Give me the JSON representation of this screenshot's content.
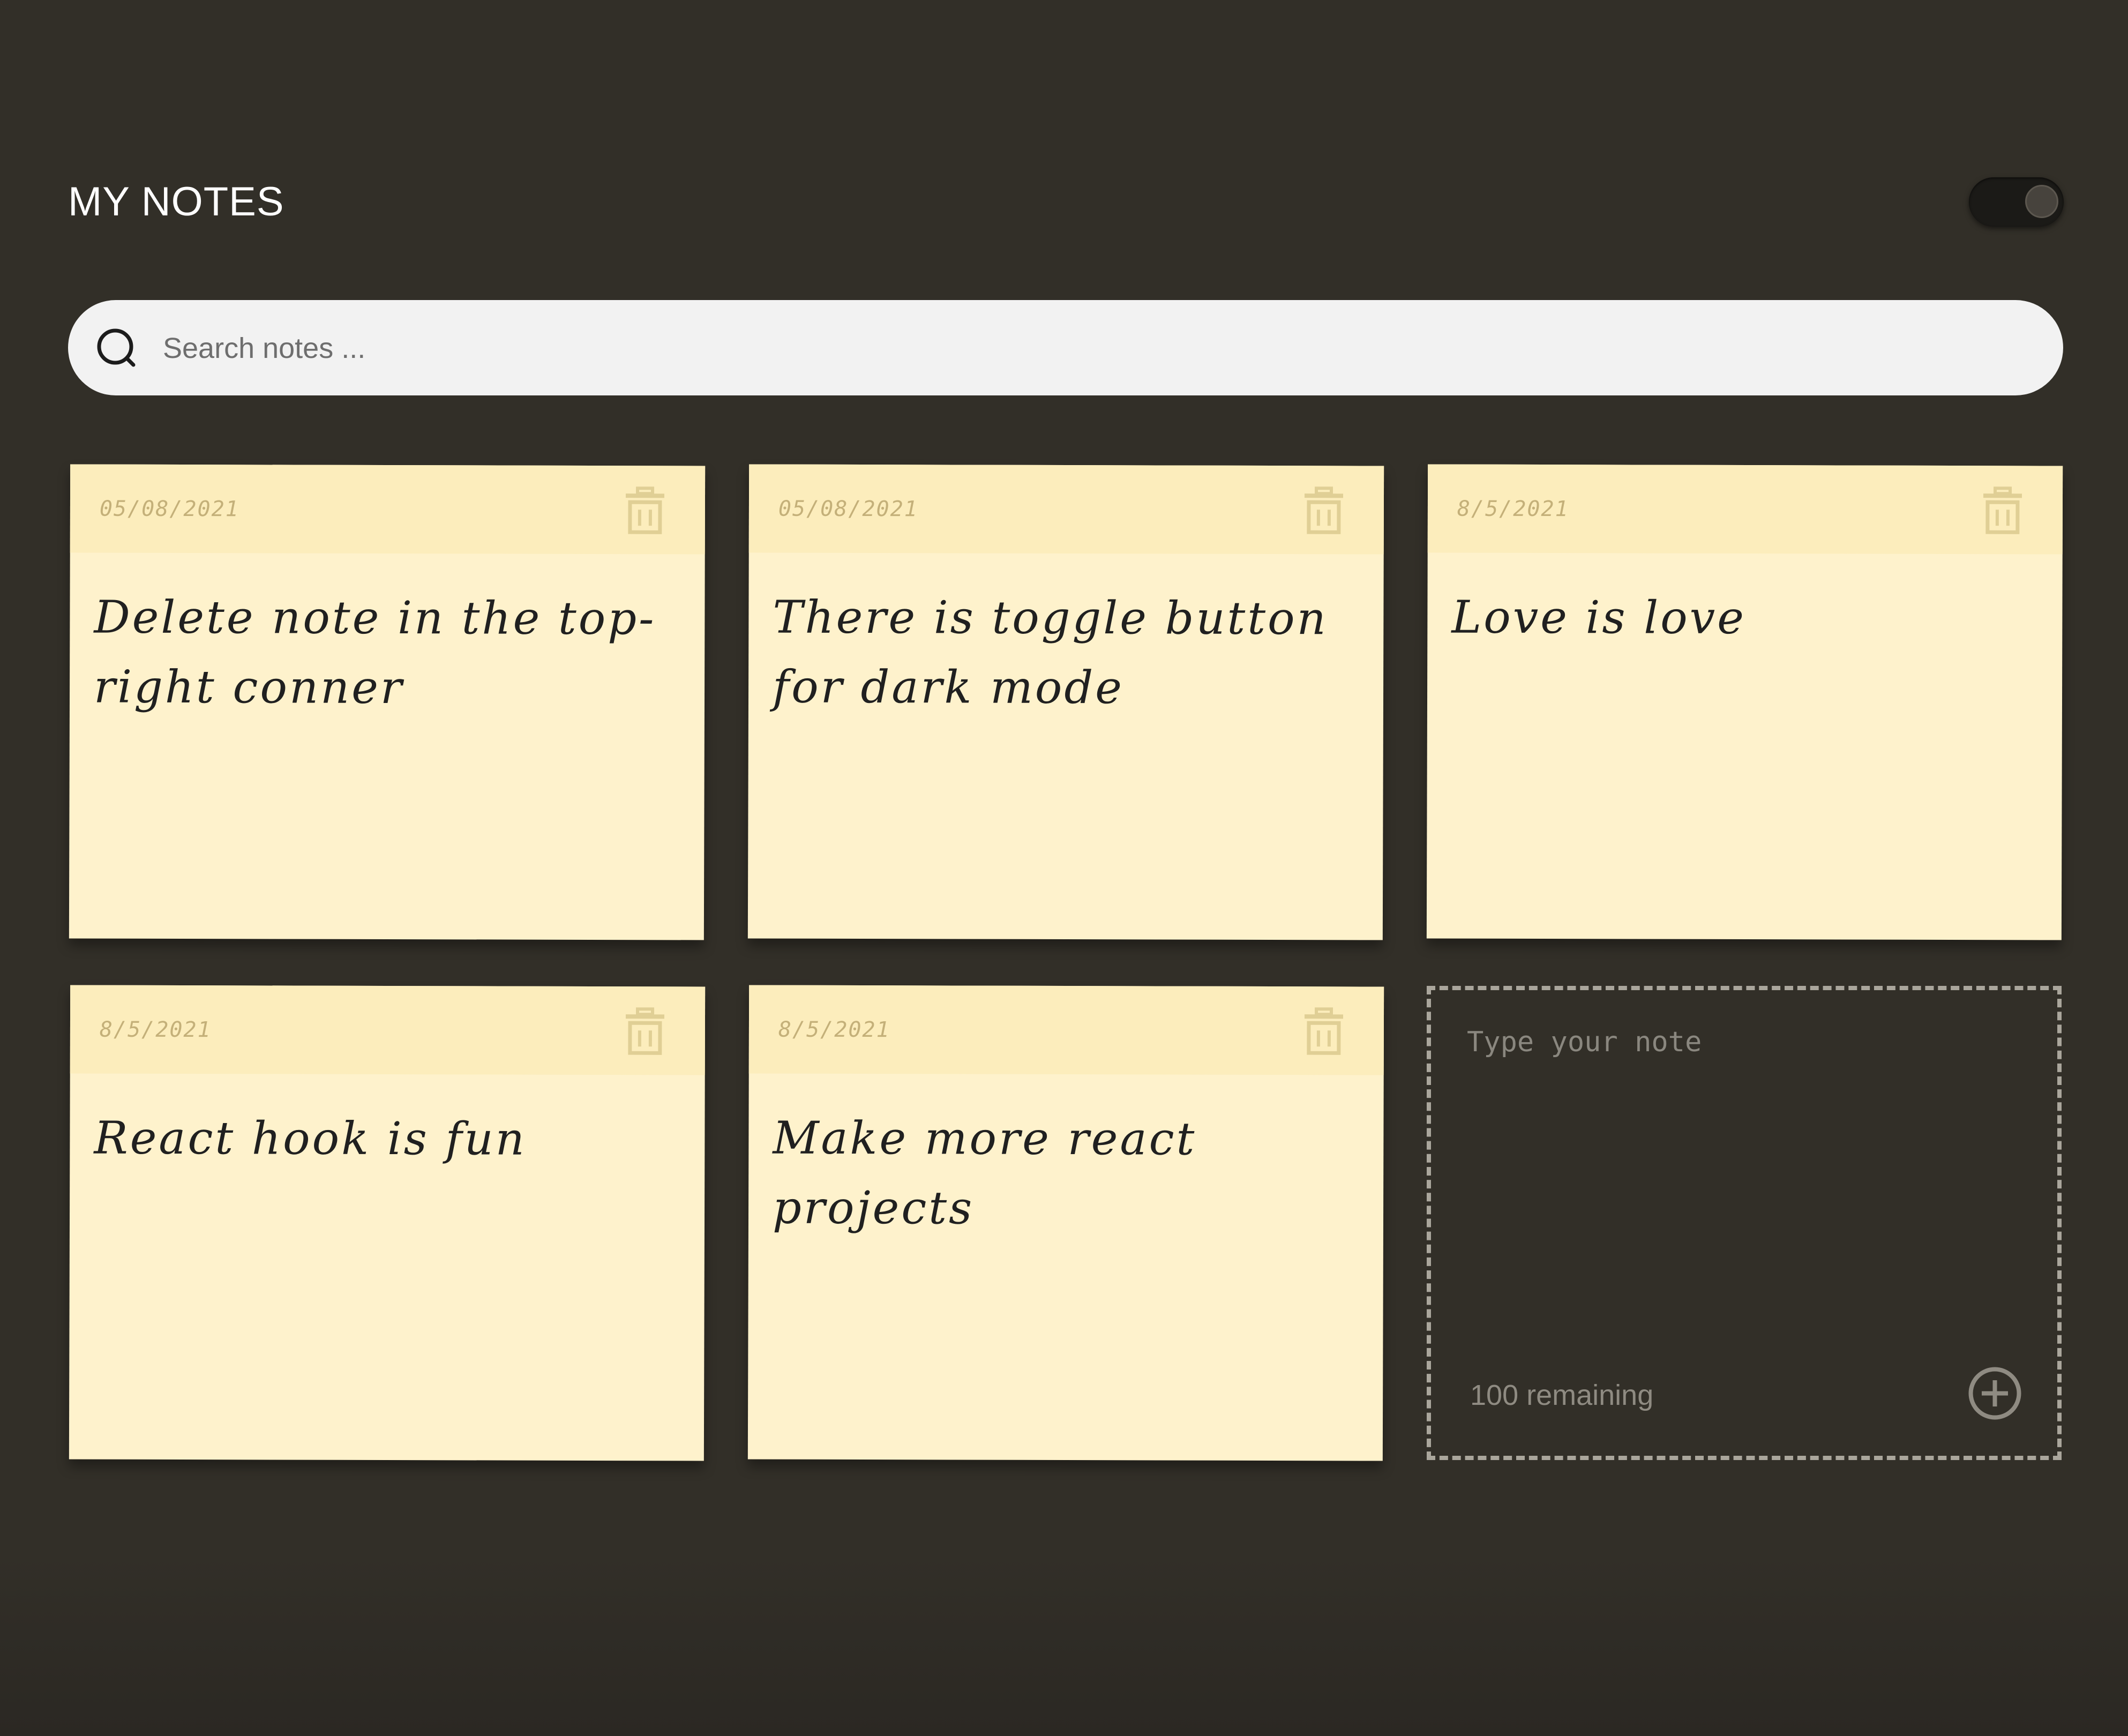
{
  "header": {
    "title": "MY NOTES",
    "dark_mode_toggle": {
      "state": "on",
      "icon": "toggle-icon"
    }
  },
  "search": {
    "placeholder": "Search notes ...",
    "value": "",
    "icon": "search-icon"
  },
  "notes": [
    {
      "date": "05/08/2021",
      "text": "Delete note in the top-right conner",
      "delete_icon": "trash-icon"
    },
    {
      "date": "05/08/2021",
      "text": "There is toggle button for dark mode",
      "delete_icon": "trash-icon"
    },
    {
      "date": "8/5/2021",
      "text": "Love is love",
      "delete_icon": "trash-icon"
    },
    {
      "date": "8/5/2021",
      "text": "React hook is fun",
      "delete_icon": "trash-icon"
    },
    {
      "date": "8/5/2021",
      "text": "Make more react projects",
      "delete_icon": "trash-icon"
    }
  ],
  "new_note": {
    "placeholder": "Type your note",
    "value": "",
    "remaining": "100 remaining",
    "save_icon": "plus-circle-icon"
  },
  "colors": {
    "background": "#322f28",
    "note_body": "#fef2cc",
    "note_header": "#fcedbc",
    "note_date": "#c4b079",
    "search_bg": "#f2f2f2"
  }
}
